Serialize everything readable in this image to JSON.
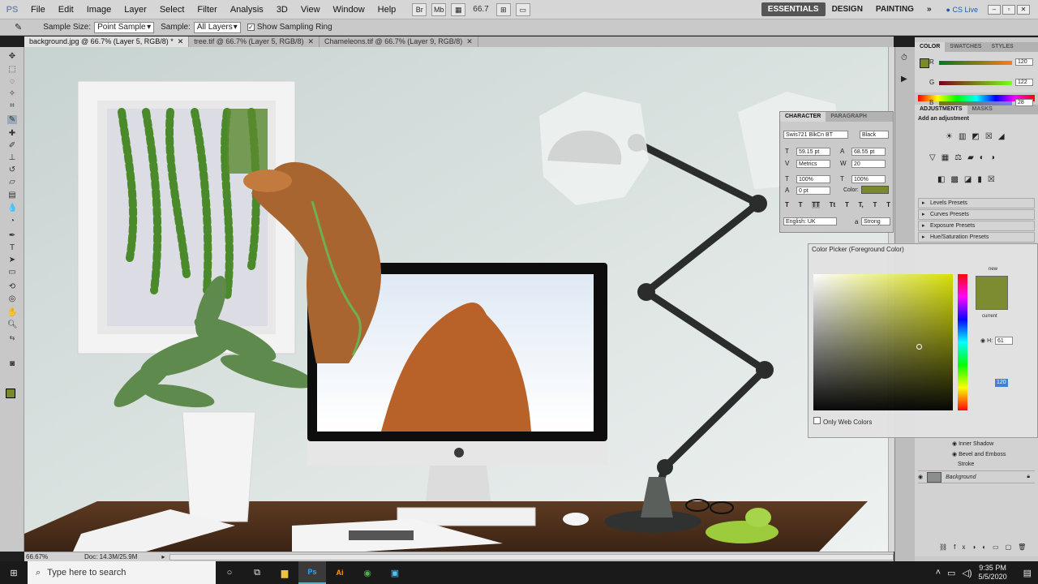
{
  "app": {
    "logo": "PS"
  },
  "menu": [
    "File",
    "Edit",
    "Image",
    "Layer",
    "Select",
    "Filter",
    "Analysis",
    "3D",
    "View",
    "Window",
    "Help"
  ],
  "zoom_level": "66.7",
  "workspaces": [
    "ESSENTIALS",
    "DESIGN",
    "PAINTING"
  ],
  "cs_live": "CS Live",
  "options": {
    "sample_size_label": "Sample Size:",
    "sample_size_value": "Point Sample",
    "sample_label": "Sample:",
    "sample_value": "All Layers",
    "show_ring": "Show Sampling Ring"
  },
  "doc_tabs": [
    "background.jpg @ 66.7% (Layer 5, RGB/8) *",
    "tree.tif @ 66.7% (Layer 5, RGB/8)",
    "Chameleons.tif @ 66.7% (Layer 9, RGB/8)"
  ],
  "status": {
    "zoom": "66.67%",
    "doc": "Doc: 14.3M/25.9M"
  },
  "color_panel": {
    "tabs": [
      "COLOR",
      "SWATCHES",
      "STYLES"
    ],
    "r_label": "R",
    "g_label": "G",
    "b_label": "B",
    "r": "120",
    "g": "122",
    "b": "28",
    "fg_color": "#7a8a2a"
  },
  "adjust_panel": {
    "tabs": [
      "ADJUSTMENTS",
      "MASKS"
    ],
    "title": "Add an adjustment",
    "presets": [
      "Levels Presets",
      "Curves Presets",
      "Exposure Presets",
      "Hue/Saturation Presets"
    ]
  },
  "layers": {
    "effects": [
      "Inner Shadow",
      "Bevel and Emboss",
      "Stroke"
    ],
    "background": "Background"
  },
  "character": {
    "tabs": [
      "CHARACTER",
      "PARAGRAPH"
    ],
    "font": "Swis721 BlkCn BT",
    "style": "Black",
    "size": "59.15 pt",
    "leading": "68.55 pt",
    "kerning": "Metrics",
    "tracking": "20",
    "vscale": "100%",
    "hscale": "100%",
    "baseline": "0 pt",
    "color_label": "Color:",
    "language": "English: UK",
    "aa_label": "a",
    "aa": "Strong",
    "text_color": "#7a8a2a",
    "style_buttons": [
      "T",
      "T",
      "TT",
      "Tt",
      "T",
      "T,",
      "T",
      "T"
    ]
  },
  "color_picker": {
    "title": "Color Picker (Foreground Color)",
    "new_label": "new",
    "current_label": "current",
    "h_label": "H:",
    "h_value": "61",
    "active_value": "120",
    "web_colors": "Only Web Colors"
  },
  "taskbar": {
    "search_placeholder": "Type here to search",
    "time": "9:35 PM",
    "date": "5/5/2020"
  }
}
